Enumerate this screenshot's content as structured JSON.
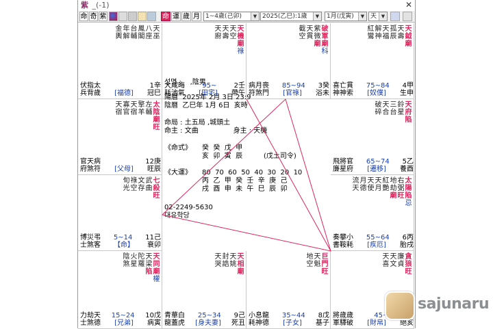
{
  "window": {
    "title": "紫",
    "subtitle": "_(-1)",
    "close": "✕"
  },
  "toolbar": {
    "buttons": [
      "命",
      "奇",
      "紫"
    ],
    "tabs": [
      "命",
      "運",
      "歲",
      "月"
    ],
    "dd1": "1~4歲(己卯)",
    "dd2": "2025(乙巳):1歲",
    "dd3": "1月(戊寅)",
    "dd4": "天"
  },
  "cells": [
    {
      "id": "si",
      "stars": [
        [
          "天",
          "巫"
        ],
        [
          "八",
          "座"
        ],
        [
          "鳳",
          "閣"
        ],
        [
          "台",
          "輔"
        ],
        [
          "年",
          "解"
        ],
        [
          "金",
          "輿"
        ]
      ],
      "row1": [
        "伏指太",
        "",
        "1辛"
      ],
      "row2": [
        "兵背歲",
        "[福德]",
        "冠巳"
      ]
    },
    {
      "id": "o",
      "stars": [
        [
          "天",
          "機",
          "廟",
          "祿"
        ],
        [
          "天",
          "空"
        ],
        [
          "天",
          "壽"
        ],
        [
          "天",
          "廚"
        ]
      ],
      "row1": [
        "大咸晦",
        "95~",
        "2壬"
      ],
      "row2": [
        "耗池氣",
        "[田宅]",
        "帶午"
      ]
    },
    {
      "id": "mi",
      "stars": [
        [
          "破",
          "軍",
          "廟",
          "科"
        ],
        [
          "紫",
          "微",
          "廟"
        ],
        [
          "天",
          "貫"
        ],
        [
          "截",
          "空"
        ]
      ],
      "row1": [
        "病月喪",
        "85~94",
        "3癸"
      ],
      "row2": [
        "符煞門",
        "[官祿]",
        "浴未"
      ]
    },
    {
      "id": "sin",
      "stars": [
        [
          "天",
          "鉞",
          "廟"
        ],
        [
          "天",
          "壽"
        ],
        [
          "孤",
          "辰"
        ],
        [
          "天",
          "福"
        ],
        [
          "解",
          "神"
        ],
        [
          "紅",
          "鸞"
        ]
      ],
      "row1": [
        "喜亡貫",
        "75~84",
        "4甲"
      ],
      "row2": [
        "神神索",
        "[奴僕]",
        "生申"
      ]
    },
    {
      "id": "jin",
      "stars": [
        [
          "太",
          "陰",
          "廟",
          "旺"
        ],
        [
          "左",
          "輔"
        ],
        [
          "擎",
          "羊"
        ],
        [
          "天",
          "宿"
        ],
        [
          "寡",
          "官"
        ],
        [
          "天",
          "宿"
        ]
      ],
      "row1": [
        "官天病",
        "",
        "12庚"
      ],
      "row2": [
        "府煞符",
        "[父母]",
        "旺辰"
      ]
    },
    {
      "id": "yu",
      "stars": [
        [
          "天",
          "府",
          "陷"
        ],
        [
          "鈴",
          "星"
        ],
        [
          "三",
          "台"
        ],
        [
          "天",
          "合"
        ],
        [
          "破",
          "碎"
        ]
      ],
      "row1": [
        "飛將官",
        "65~74",
        "5乙"
      ],
      "row2": [
        "廉星府",
        "[遷移]",
        "養酉"
      ]
    },
    {
      "id": "myo",
      "stars": [
        [
          "七",
          "殺",
          "旺"
        ],
        [
          "武",
          "曲"
        ],
        [
          "文",
          "存"
        ],
        [
          "祿",
          "空"
        ],
        [
          "旬",
          "光"
        ]
      ],
      "row1": [
        "博災弔",
        "5~14",
        "11己"
      ],
      "row2": [
        "士煞客",
        "【命】",
        "衰卯"
      ]
    },
    {
      "id": "sul",
      "stars": [
        [
          "太",
          "陽",
          "陷",
          "忌"
        ],
        [
          "右",
          "弼",
          "旺"
        ],
        [
          "地",
          "劫",
          "廟"
        ],
        [
          "紅",
          "艷"
        ],
        [
          "天",
          "月"
        ],
        [
          "天",
          "使"
        ],
        [
          "月",
          "德"
        ],
        [
          "流",
          "天"
        ]
      ],
      "row1": [
        "奏攀小",
        "55~64",
        "6丙"
      ],
      "row2": [
        "書鞍耗",
        "[疾厄]",
        "胎戌"
      ]
    },
    {
      "id": "in",
      "stars": [
        [
          "天",
          "同",
          "廟",
          "權"
        ],
        [
          "天",
          "梁",
          "陷"
        ],
        [
          "陀",
          "羅"
        ],
        [
          "火",
          "星"
        ],
        [
          "陰",
          "煞"
        ]
      ],
      "row1": [
        "力劫天",
        "15~24",
        "10戊"
      ],
      "row2": [
        "士煞德",
        "[兄弟]",
        "病寅"
      ]
    },
    {
      "id": "chuk",
      "stars": [
        [
          "天",
          "相",
          "廟"
        ],
        [
          "天",
          "姚"
        ],
        [
          "封",
          "誥"
        ],
        [
          "天",
          "哭"
        ]
      ],
      "row1": [
        "青華白",
        "25~34",
        "9己"
      ],
      "row2": [
        "龍蓋虎",
        "[身夫妻]",
        "死丑"
      ]
    },
    {
      "id": "ja",
      "stars": [
        [
          "巨",
          "門",
          "旺"
        ],
        [
          "天",
          "魁"
        ],
        [
          "地",
          "空"
        ]
      ],
      "row1": [
        "小息龍",
        "35~44",
        "8戊"
      ],
      "row2": [
        "耗神德",
        "[子女]",
        "基子"
      ]
    },
    {
      "id": "hae",
      "stars": [
        [
          "貪",
          "狼",
          "旺"
        ],
        [
          "廉",
          "貞"
        ],
        [
          "天",
          "文"
        ],
        [
          "天",
          "喜"
        ]
      ],
      "row1": [
        "將歲歲",
        "45~",
        "7"
      ],
      "row2": [
        "軍驛破",
        "[財帛]",
        "絕亥"
      ]
    }
  ],
  "center": {
    "name": "성명 :    ,陰男",
    "solar": "陽曆  2025年 2月 3日 23:9",
    "lunar": "陰曆  乙巳年 1月 6日  亥時",
    "ju": "命局 : 土五局 ,城頭土",
    "master": "命主 : 文曲                身主 : 天機",
    "saju_label": "《命式》",
    "saju_top": "癸  癸  戊  甲",
    "saju_bot": "亥  卯  寅  辰",
    "saju_note": "(戊土司令)",
    "daeun_label": "《大運》",
    "daeun_num": "80  70  60  50  40  30  20  10",
    "daeun_top": "丙  乙  甲  癸  壬  辛  庚  己",
    "daeun_bot": "戌  酉  申  未  午  巳  辰  卯",
    "phone": "02-2249-5630",
    "company": "대유학당"
  },
  "watermark": "sajunaru",
  "colors": {
    "accent": "#e0245e",
    "blue": "#1a3fb0",
    "line": "#e0245e"
  }
}
